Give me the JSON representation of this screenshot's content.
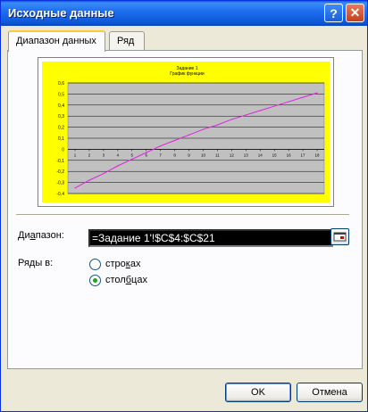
{
  "window": {
    "title": "Исходные данные"
  },
  "tabs": [
    {
      "label": "Диапазон данных",
      "active": true
    },
    {
      "label": "Ряд",
      "active": false
    }
  ],
  "range": {
    "label_pre": "Ди",
    "label_ul": "а",
    "label_post": "пазон:",
    "value": "=Задание 1'!$C$4:$C$21"
  },
  "series_in": {
    "label": "Ряды в:",
    "rows_pre": "стро",
    "rows_ul": "к",
    "rows_post": "ах",
    "cols_pre": "стол",
    "cols_ul": "б",
    "cols_post": "цах",
    "selected": "columns"
  },
  "buttons": {
    "ok": "OK",
    "cancel": "Отмена"
  },
  "colors": {
    "chart_bg": "#ffff00",
    "plot_bg": "#c0c0c0",
    "line": "#e020e0"
  },
  "chart_data": {
    "type": "line",
    "title": "Задание 1",
    "subtitle": "График функции",
    "categories": [
      "1",
      "2",
      "3",
      "4",
      "5",
      "6",
      "7",
      "8",
      "9",
      "10",
      "11",
      "12",
      "13",
      "14",
      "15",
      "16",
      "17",
      "18"
    ],
    "series": [
      {
        "values": [
          -0.35,
          -0.28,
          -0.22,
          -0.15,
          -0.09,
          -0.03,
          0.03,
          0.08,
          0.13,
          0.18,
          0.22,
          0.27,
          0.31,
          0.35,
          0.39,
          0.43,
          0.47,
          0.51
        ]
      }
    ],
    "y_ticks": [
      "0,6",
      "0,5",
      "0,4",
      "0,3",
      "0,2",
      "0,1",
      "0",
      "-0,1",
      "-0,2",
      "-0,3",
      "-0,4"
    ],
    "ylim": [
      -0.4,
      0.6
    ],
    "grid": true
  }
}
